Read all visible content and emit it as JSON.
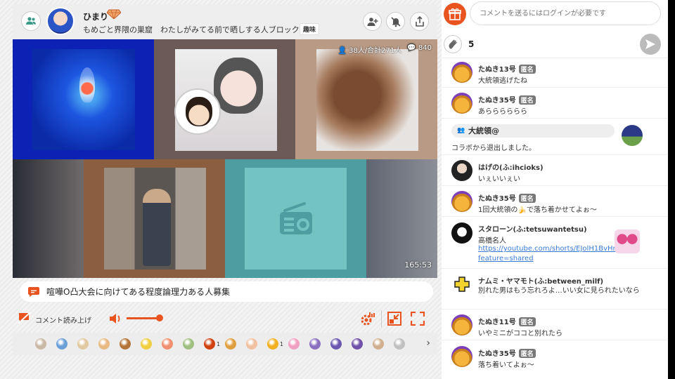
{
  "header": {
    "host_name": "ひまり",
    "channel_title": "もめごと界隈の巣窟　わたしがみてる前で晒しする人ブロック",
    "genre": "趣味"
  },
  "video": {
    "listeners": "38人/合計271人",
    "comment_count": "840",
    "elapsed": "165:53"
  },
  "telop": {
    "text": "喧嘩O凸大会に向けてある程度論理力ある人募集"
  },
  "controls": {
    "tts_label": "コメント読み上げ",
    "volume": 0.9
  },
  "gifts": {
    "items": [
      {
        "icon": "gift-icon",
        "color": "#c9b9a6",
        "count": ""
      },
      {
        "icon": "gift-icon",
        "color": "#6aa0d8",
        "count": ""
      },
      {
        "icon": "gift-icon",
        "color": "#e0c9a0",
        "count": ""
      },
      {
        "icon": "gift-icon",
        "color": "#e8b980",
        "count": ""
      },
      {
        "icon": "gift-icon",
        "color": "#b5753a",
        "count": ""
      },
      {
        "icon": "gift-icon",
        "color": "#f0d040",
        "count": ""
      },
      {
        "icon": "gift-icon",
        "color": "#f09070",
        "count": ""
      },
      {
        "icon": "gift-icon",
        "color": "#a0c080",
        "count": ""
      },
      {
        "icon": "gift-icon",
        "color": "#d04010",
        "count": "1"
      },
      {
        "icon": "gift-icon",
        "color": "#e0a040",
        "count": ""
      },
      {
        "icon": "gift-icon",
        "color": "#f0c0a0",
        "count": ""
      },
      {
        "icon": "gift-icon",
        "color": "#f0b020",
        "count": "1"
      },
      {
        "icon": "gift-icon",
        "color": "#f0a0c0",
        "count": ""
      },
      {
        "icon": "gift-icon",
        "color": "#8a70c0",
        "count": ""
      },
      {
        "icon": "gift-icon",
        "color": "#6a58b0",
        "count": ""
      },
      {
        "icon": "gift-icon",
        "color": "#7050a8",
        "count": ""
      },
      {
        "icon": "gift-icon",
        "color": "#d0b090",
        "count": ""
      },
      {
        "icon": "gift-icon",
        "color": "#c0c0c0",
        "count": ""
      }
    ]
  },
  "comment_box": {
    "placeholder": "コメントを送るにはログインが必要です",
    "clap_count": "5"
  },
  "comments": [
    {
      "name": "たぬき13号",
      "tag": "匿名",
      "text": "大統領逃げたね"
    },
    {
      "name": "たぬき35号",
      "tag": "匿名",
      "text": "あらららららら"
    },
    {
      "name": "はげの(ふ:ihcioks)",
      "tag": "",
      "text": "いぇいいぇい"
    },
    {
      "name": "たぬき35号",
      "tag": "匿名",
      "text": "1回大統領の🍌で落ち着かせてよぉ〜"
    },
    {
      "name": "スタローン(ふ:tetsuwantetsu)",
      "tag": "",
      "text": "高橋名人",
      "link": "https://youtube.com/shorts/EJolH1BvHnU?feature=shared"
    },
    {
      "name": "ナムミ・ヤマモト(ふ:between_milf)",
      "tag": "",
      "text": "別れた男はもう忘れろよ…いい女に見られたいなら"
    },
    {
      "name": "たぬき11号",
      "tag": "匿名",
      "text": "いやミニがココと別れたら"
    },
    {
      "name": "たぬき35号",
      "tag": "匿名",
      "text": "落ち着いてよぉ〜"
    }
  ],
  "notice": {
    "user": "大統領@",
    "text": "コラボから退出しました。"
  },
  "colors": {
    "accent": "#e8531f",
    "badge": "#777777"
  }
}
